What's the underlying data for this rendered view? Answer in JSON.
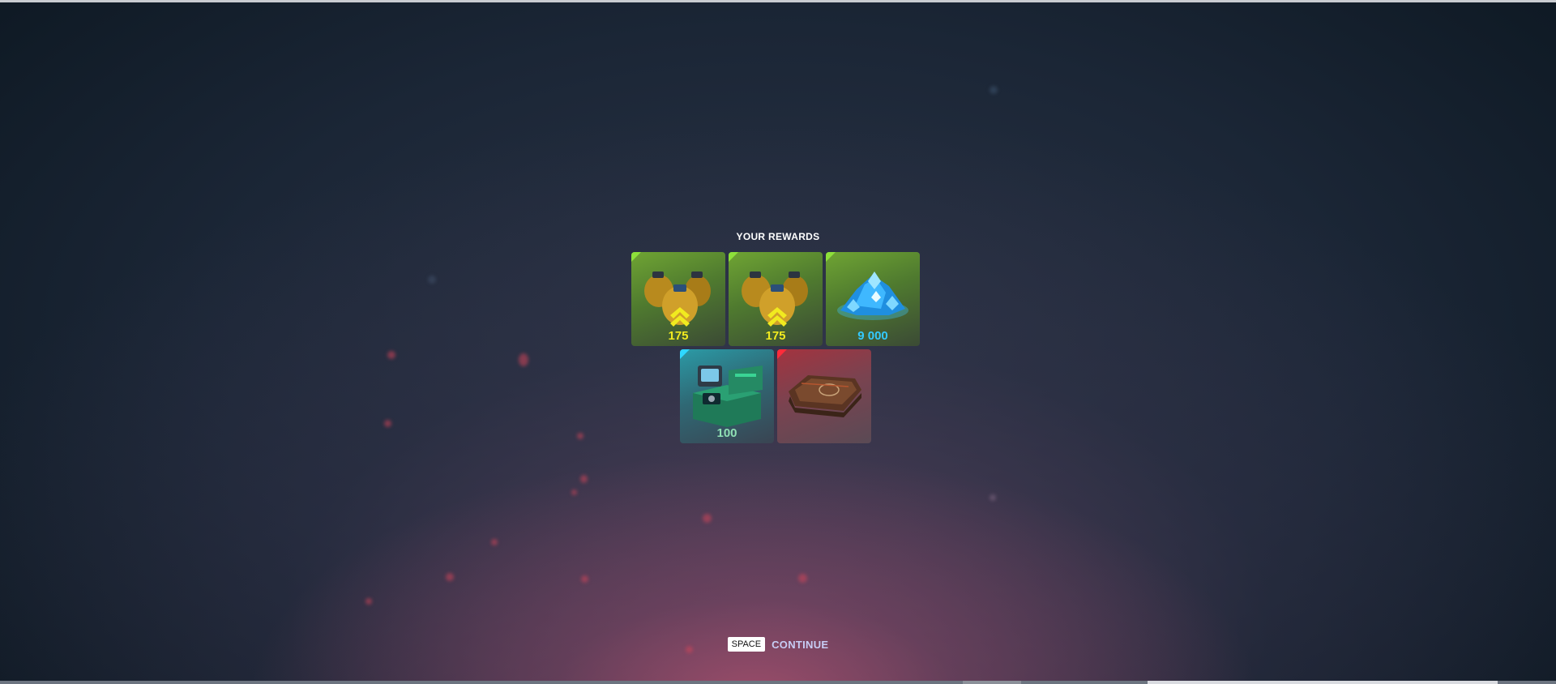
{
  "header": {
    "title": "YOUR REWARDS"
  },
  "rewards": [
    {
      "name": "overdrive-supplies",
      "amount": "175",
      "rarity": "green",
      "icon": "gold-canisters-icon",
      "amount_color": "#f1ea1f"
    },
    {
      "name": "overdrive-supplies",
      "amount": "175",
      "rarity": "green",
      "icon": "gold-canisters-icon",
      "amount_color": "#f1ea1f"
    },
    {
      "name": "crystals",
      "amount": "9 000",
      "rarity": "green",
      "icon": "crystals-icon",
      "amount_color": "#33c9ff"
    },
    {
      "name": "container",
      "amount": "100",
      "rarity": "blue",
      "icon": "container-icon",
      "amount_color": "#8fe0b4"
    },
    {
      "name": "hull-skin",
      "amount": "",
      "rarity": "red",
      "icon": "tank-hull-icon",
      "amount_color": ""
    }
  ],
  "footer": {
    "key": "SPACE",
    "action": "CONTINUE"
  },
  "colors": {
    "rarity_green": "#8de03a",
    "rarity_blue": "#2ed8ff",
    "rarity_red": "#ff2b3a"
  }
}
